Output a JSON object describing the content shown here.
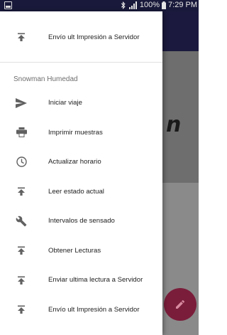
{
  "status_bar": {
    "battery_percent": "100%",
    "time": "7:29 PM"
  },
  "background": {
    "content_text": "n"
  },
  "drawer": {
    "header_item": {
      "label": "Envío ult Impresión a Servidor",
      "icon": "upload-to-top-icon"
    },
    "section_label": "Snowman Humedad",
    "items": [
      {
        "label": "Iniciar viaje",
        "icon": "send-icon"
      },
      {
        "label": "Imprimir muestras",
        "icon": "printer-icon"
      },
      {
        "label": "Actualizar horario",
        "icon": "clock-icon"
      },
      {
        "label": "Leer estado actual",
        "icon": "upload-to-top-icon"
      },
      {
        "label": "Intervalos de sensado",
        "icon": "wrench-icon"
      },
      {
        "label": "Obtener Lecturas",
        "icon": "upload-to-top-icon"
      },
      {
        "label": "Enviar ultima lectura a Servidor",
        "icon": "upload-to-top-icon"
      },
      {
        "label": "Envío ult Impresión a Servidor",
        "icon": "upload-to-top-icon"
      }
    ]
  },
  "colors": {
    "app_bar": "#1b1a3e",
    "fab": "#7a1d3a",
    "icon": "#616161",
    "text": "#212121"
  }
}
